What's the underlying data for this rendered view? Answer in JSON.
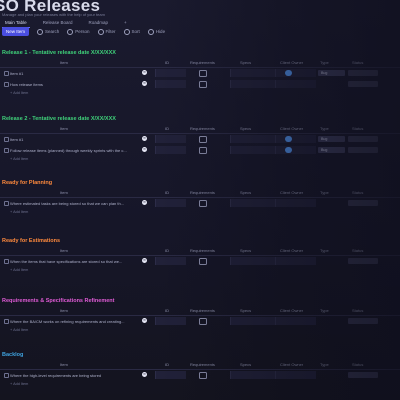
{
  "header": {
    "title": "SO Releases",
    "subtitle": "Manage and plan your releases with the help of your team"
  },
  "tabs": [
    {
      "label": "Main Table",
      "active": true
    },
    {
      "label": "Release Board",
      "active": false
    },
    {
      "label": "Roadmap",
      "active": false
    },
    {
      "label": "+",
      "active": false
    }
  ],
  "toolbar": {
    "new_item_label": "New Item",
    "search_label": "Search",
    "person_label": "Person",
    "filter_label": "Filter",
    "sort_label": "Sort",
    "hide_label": "Hide"
  },
  "columns": {
    "item": "Item",
    "id": "ID",
    "requirements": "Requirements",
    "specs": "Specs",
    "client_owner": "Client Owner",
    "type": "Type",
    "status": "Status"
  },
  "groups": [
    {
      "title": "Release 1 - Tentative release date X/XX/XXX",
      "color": "#3fd27a",
      "rows": [
        {
          "name": "Item #1",
          "has_owner": true,
          "pill": "Bug"
        },
        {
          "name": "How release items",
          "has_owner": false,
          "pill": ""
        }
      ],
      "add_label": "+ Add Item"
    },
    {
      "title": "Release 2 - Tentative release date X/XX/XXX",
      "color": "#3fd27a",
      "rows": [
        {
          "name": "Item #1",
          "has_owner": true,
          "pill": "Bug"
        },
        {
          "name": "Follow release items (planned) through weekly sprints with the c...",
          "has_owner": true,
          "pill": "Bug"
        }
      ],
      "add_label": "+ Add Item"
    },
    {
      "title": "Ready for Planning",
      "color": "#ff8a3d",
      "rows": [
        {
          "name": "Where estimated tasks are being stored so that we can plan th...",
          "has_owner": false,
          "pill": ""
        }
      ],
      "add_label": "+ Add Item"
    },
    {
      "title": "Ready for Estimations",
      "color": "#ff8a3d",
      "rows": [
        {
          "name": "When the items that have specifications are stored so that we...",
          "has_owner": false,
          "pill": ""
        }
      ],
      "add_label": "+ Add Item"
    },
    {
      "title": "Requirements & Specifications Refinement",
      "color": "#e05bd6",
      "rows": [
        {
          "name": "Where the BA/CM works on refining requirements and creating...",
          "has_owner": false,
          "pill": ""
        }
      ],
      "add_label": "+ Add Item"
    },
    {
      "title": "Backlog",
      "color": "#3fa3e0",
      "rows": [
        {
          "name": "Where the high-level requirements are being stored",
          "has_owner": false,
          "pill": ""
        }
      ],
      "add_label": "+ Add Item"
    }
  ]
}
